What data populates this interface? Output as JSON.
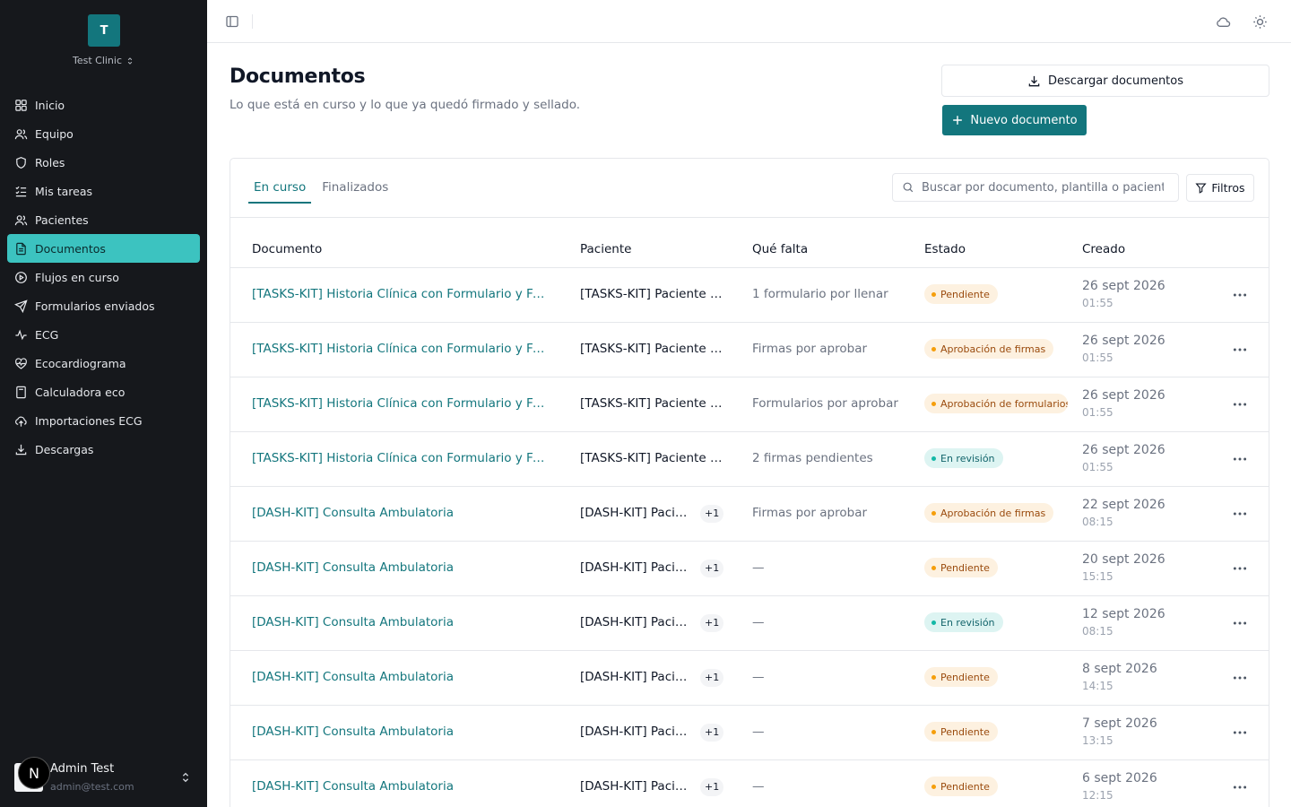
{
  "org": {
    "initial": "T",
    "name": "Test Clinic"
  },
  "nav": [
    {
      "label": "Inicio",
      "icon": "grid-icon",
      "active": false
    },
    {
      "label": "Equipo",
      "icon": "users-icon",
      "active": false
    },
    {
      "label": "Roles",
      "icon": "shield-icon",
      "active": false
    },
    {
      "label": "Mis tareas",
      "icon": "list-checks-icon",
      "active": false
    },
    {
      "label": "Pacientes",
      "icon": "patients-icon",
      "active": false
    },
    {
      "label": "Documentos",
      "icon": "file-text-icon",
      "active": true
    },
    {
      "label": "Flujos en curso",
      "icon": "play-circle-icon",
      "active": false
    },
    {
      "label": "Formularios enviados",
      "icon": "send-icon",
      "active": false
    },
    {
      "label": "ECG",
      "icon": "activity-icon",
      "active": false
    },
    {
      "label": "Ecocardiograma",
      "icon": "heart-icon",
      "active": false
    },
    {
      "label": "Calculadora eco",
      "icon": "calculator-icon",
      "active": false
    },
    {
      "label": "Importaciones ECG",
      "icon": "cloud-upload-icon",
      "active": false
    },
    {
      "label": "Descargas",
      "icon": "download-icon",
      "active": false
    }
  ],
  "user": {
    "badge": "N",
    "name": "Admin Test",
    "email": "admin@test.com"
  },
  "page": {
    "title": "Documentos",
    "subtitle": "Lo que está en curso y lo que ya quedó firmado y sellado.",
    "download_label": "Descargar documentos",
    "new_label": "Nuevo documento"
  },
  "tabs": [
    {
      "label": "En curso",
      "active": true
    },
    {
      "label": "Finalizados",
      "active": false
    }
  ],
  "search": {
    "placeholder": "Buscar por documento, plantilla o paciente"
  },
  "filters_label": "Filtros",
  "table": {
    "headers": {
      "document": "Documento",
      "patient": "Paciente",
      "missing": "Qué falta",
      "status": "Estado",
      "created": "Creado"
    },
    "rows": [
      {
        "document": "[TASKS-KIT] Historia Clínica con Formulario y Firmas",
        "patient": "[TASKS-KIT] Paciente Flujo",
        "extra": "",
        "missing": "1 formulario por llenar",
        "status": "Pendiente",
        "tone": "warn",
        "date": "26 sept 2026",
        "time": "01:55"
      },
      {
        "document": "[TASKS-KIT] Historia Clínica con Formulario y Firmas",
        "patient": "[TASKS-KIT] Paciente Aprobación",
        "extra": "",
        "missing": "Firmas por aprobar",
        "status": "Aprobación de firmas",
        "tone": "warn",
        "date": "26 sept 2026",
        "time": "01:55"
      },
      {
        "document": "[TASKS-KIT] Historia Clínica con Formulario y Firmas",
        "patient": "[TASKS-KIT] Paciente Aprobación",
        "extra": "",
        "missing": "Formularios por aprobar",
        "status": "Aprobación de formularios",
        "tone": "warn",
        "date": "26 sept 2026",
        "time": "01:55"
      },
      {
        "document": "[TASKS-KIT] Historia Clínica con Formulario y Firmas",
        "patient": "[TASKS-KIT] Paciente Flujo",
        "extra": "",
        "missing": "2 firmas pendientes",
        "status": "En revisión",
        "tone": "info",
        "date": "26 sept 2026",
        "time": "01:55"
      },
      {
        "document": "[DASH-KIT] Consulta Ambulatoria",
        "patient": "[DASH-KIT] Paciente Demo",
        "extra": "+1",
        "missing": "Firmas por aprobar",
        "status": "Aprobación de firmas",
        "tone": "warn",
        "date": "22 sept 2026",
        "time": "08:15"
      },
      {
        "document": "[DASH-KIT] Consulta Ambulatoria",
        "patient": "[DASH-KIT] Paciente Demo",
        "extra": "+1",
        "missing": "—",
        "status": "Pendiente",
        "tone": "warn",
        "date": "20 sept 2026",
        "time": "15:15"
      },
      {
        "document": "[DASH-KIT] Consulta Ambulatoria",
        "patient": "[DASH-KIT] Paciente Demo",
        "extra": "+1",
        "missing": "—",
        "status": "En revisión",
        "tone": "info",
        "date": "12 sept 2026",
        "time": "08:15"
      },
      {
        "document": "[DASH-KIT] Consulta Ambulatoria",
        "patient": "[DASH-KIT] Paciente Demo",
        "extra": "+1",
        "missing": "—",
        "status": "Pendiente",
        "tone": "warn",
        "date": "8 sept 2026",
        "time": "14:15"
      },
      {
        "document": "[DASH-KIT] Consulta Ambulatoria",
        "patient": "[DASH-KIT] Paciente Demo",
        "extra": "+1",
        "missing": "—",
        "status": "Pendiente",
        "tone": "warn",
        "date": "7 sept 2026",
        "time": "13:15"
      },
      {
        "document": "[DASH-KIT] Consulta Ambulatoria",
        "patient": "[DASH-KIT] Paciente Demo",
        "extra": "+1",
        "missing": "—",
        "status": "Pendiente",
        "tone": "warn",
        "date": "6 sept 2026",
        "time": "12:15"
      }
    ]
  }
}
